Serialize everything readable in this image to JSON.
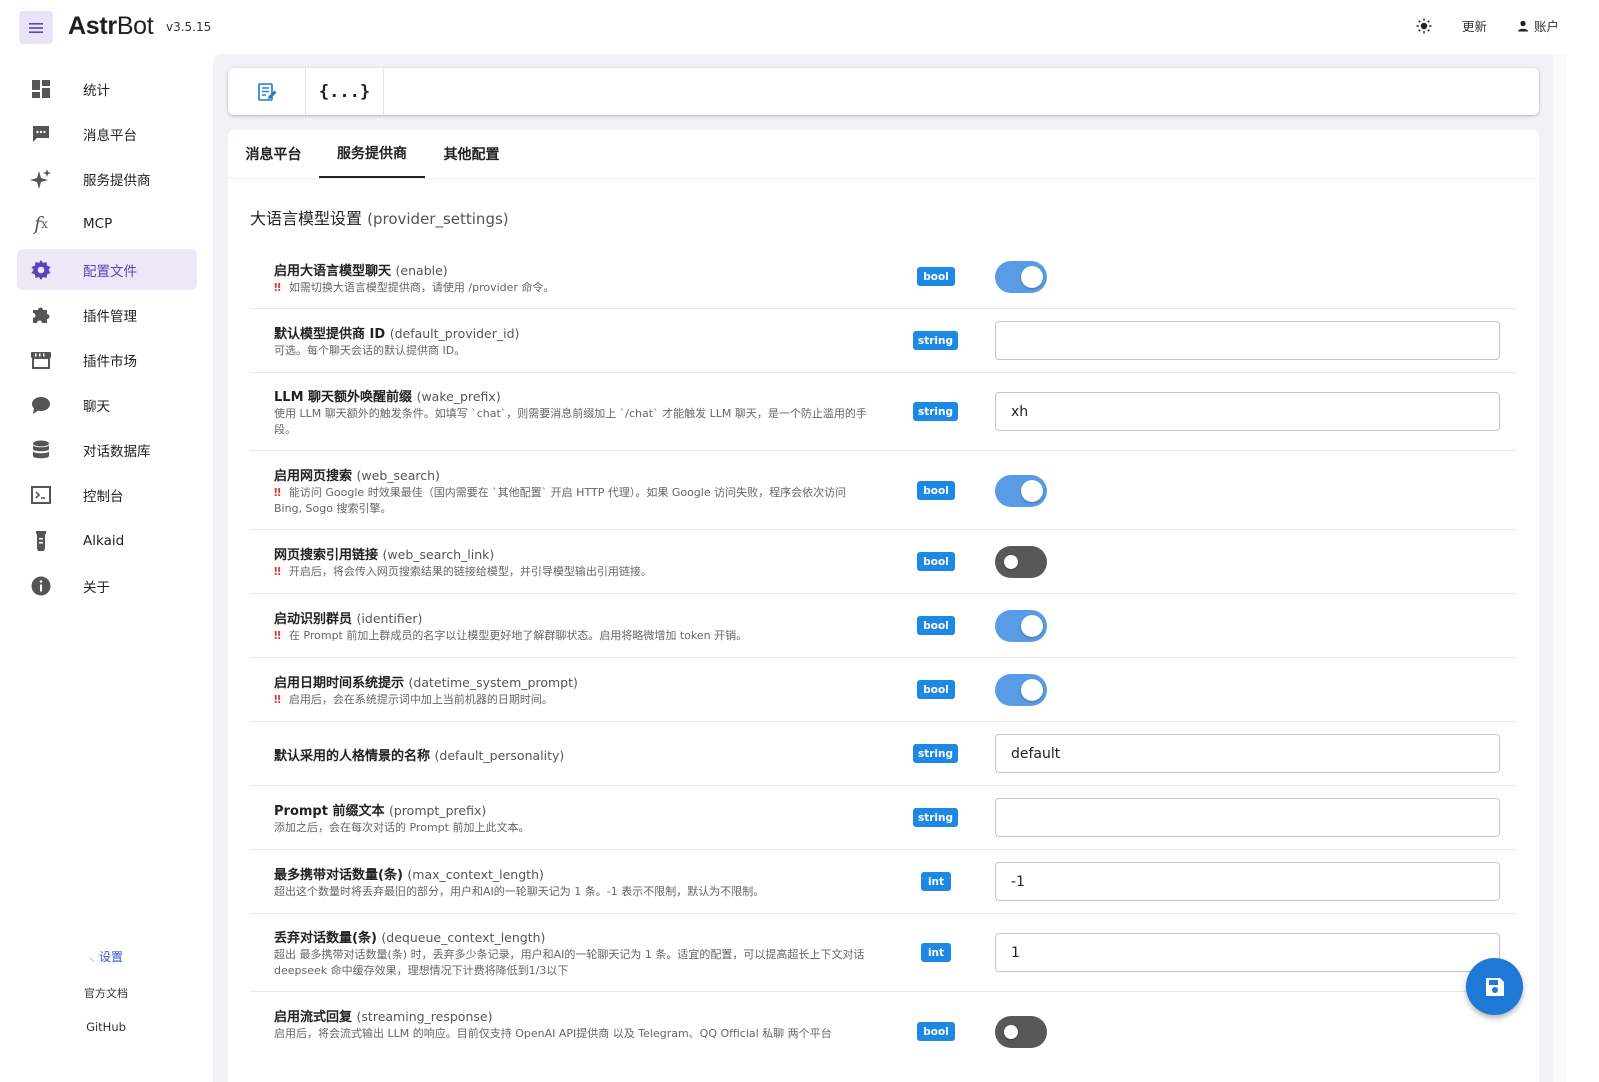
{
  "header": {
    "brand_strong": "Astr",
    "brand_rest": "Bot",
    "version": "v3.5.15",
    "update_label": "更新",
    "account_label": "账户"
  },
  "sidebar": {
    "items": [
      {
        "label": "统计",
        "icon": "dashboard-icon"
      },
      {
        "label": "消息平台",
        "icon": "message-icon"
      },
      {
        "label": "服务提供商",
        "icon": "sparkle-icon"
      },
      {
        "label": "MCP",
        "icon": "function-icon"
      },
      {
        "label": "配置文件",
        "icon": "gear-icon",
        "active": true
      },
      {
        "label": "插件管理",
        "icon": "puzzle-icon"
      },
      {
        "label": "插件市场",
        "icon": "store-icon"
      },
      {
        "label": "聊天",
        "icon": "chat-icon"
      },
      {
        "label": "对话数据库",
        "icon": "database-icon"
      },
      {
        "label": "控制台",
        "icon": "console-icon"
      },
      {
        "label": "Alkaid",
        "icon": "flask-icon"
      },
      {
        "label": "关于",
        "icon": "info-icon"
      }
    ],
    "footer": {
      "settings": "设置",
      "docs": "官方文档",
      "github": "GitHub"
    }
  },
  "toolbar": {
    "visual_editor": "edit-note-icon",
    "json_editor": "{...}"
  },
  "tabs": [
    "消息平台",
    "服务提供商",
    "其他配置"
  ],
  "section": {
    "title": "大语言模型设置",
    "key": "(provider_settings)"
  },
  "rows": [
    {
      "name": "启用大语言模型聊天",
      "key": "(enable)",
      "type": "bool",
      "warn": true,
      "desc": "如需切换大语言模型提供商，请使用 /provider 命令。",
      "value": true
    },
    {
      "name": "默认模型提供商 ID",
      "key": "(default_provider_id)",
      "type": "string",
      "warn": false,
      "desc": "可选。每个聊天会话的默认提供商 ID。",
      "value": ""
    },
    {
      "name": "LLM 聊天额外唤醒前缀",
      "key": "(wake_prefix)",
      "type": "string",
      "warn": false,
      "desc": "使用 LLM 聊天额外的触发条件。如填写 `chat`，则需要消息前缀加上 `/chat` 才能触发 LLM 聊天，是一个防止滥用的手段。",
      "value": "xh"
    },
    {
      "name": "启用网页搜索",
      "key": "(web_search)",
      "type": "bool",
      "warn": true,
      "desc": "能访问 Google 时效果最佳（国内需要在 `其他配置` 开启 HTTP 代理）。如果 Google 访问失败，程序会依次访问 Bing, Sogo 搜索引擎。",
      "value": true
    },
    {
      "name": "网页搜索引用链接",
      "key": "(web_search_link)",
      "type": "bool",
      "warn": true,
      "desc": "开启后，将会传入网页搜索结果的链接给模型，并引导模型输出引用链接。",
      "value": false
    },
    {
      "name": "启动识别群员",
      "key": "(identifier)",
      "type": "bool",
      "warn": true,
      "desc": "在 Prompt 前加上群成员的名字以让模型更好地了解群聊状态。启用将略微增加 token 开销。",
      "value": true
    },
    {
      "name": "启用日期时间系统提示",
      "key": "(datetime_system_prompt)",
      "type": "bool",
      "warn": true,
      "desc": "启用后，会在系统提示词中加上当前机器的日期时间。",
      "value": true
    },
    {
      "name": "默认采用的人格情景的名称",
      "key": "(default_personality)",
      "type": "string",
      "warn": false,
      "desc": "",
      "value": "default"
    },
    {
      "name": "Prompt 前缀文本",
      "key": "(prompt_prefix)",
      "type": "string",
      "warn": false,
      "desc": "添加之后，会在每次对话的 Prompt 前加上此文本。",
      "value": ""
    },
    {
      "name": "最多携带对话数量(条)",
      "key": "(max_context_length)",
      "type": "int",
      "warn": false,
      "desc": "超出这个数量时将丢弃最旧的部分，用户和AI的一轮聊天记为 1 条。-1 表示不限制，默认为不限制。",
      "value": "-1"
    },
    {
      "name": "丢弃对话数量(条)",
      "key": "(dequeue_context_length)",
      "type": "int",
      "warn": false,
      "desc": "超出 最多携带对话数量(条) 时，丢弃多少条记录，用户和AI的一轮聊天记为 1 条。适宜的配置，可以提高超长上下文对话 deepseek 命中缓存效果，理想情况下计费将降低到1/3以下",
      "value": "1"
    },
    {
      "name": "启用流式回复",
      "key": "(streaming_response)",
      "type": "bool",
      "warn": false,
      "desc": "启用后，将会流式输出 LLM 的响应。目前仅支持 OpenAI API提供商 以及 Telegram、QQ Official 私聊 两个平台",
      "value": false
    }
  ],
  "colors": {
    "accent": "#5b43b8",
    "active_bg": "#ece8f7",
    "badge": "#1e88e5",
    "toggle_on": "#5a9be6",
    "toggle_off": "#585858",
    "warn": "#e53935",
    "fab": "#1e78d6"
  },
  "fab": {
    "icon": "save-icon"
  }
}
